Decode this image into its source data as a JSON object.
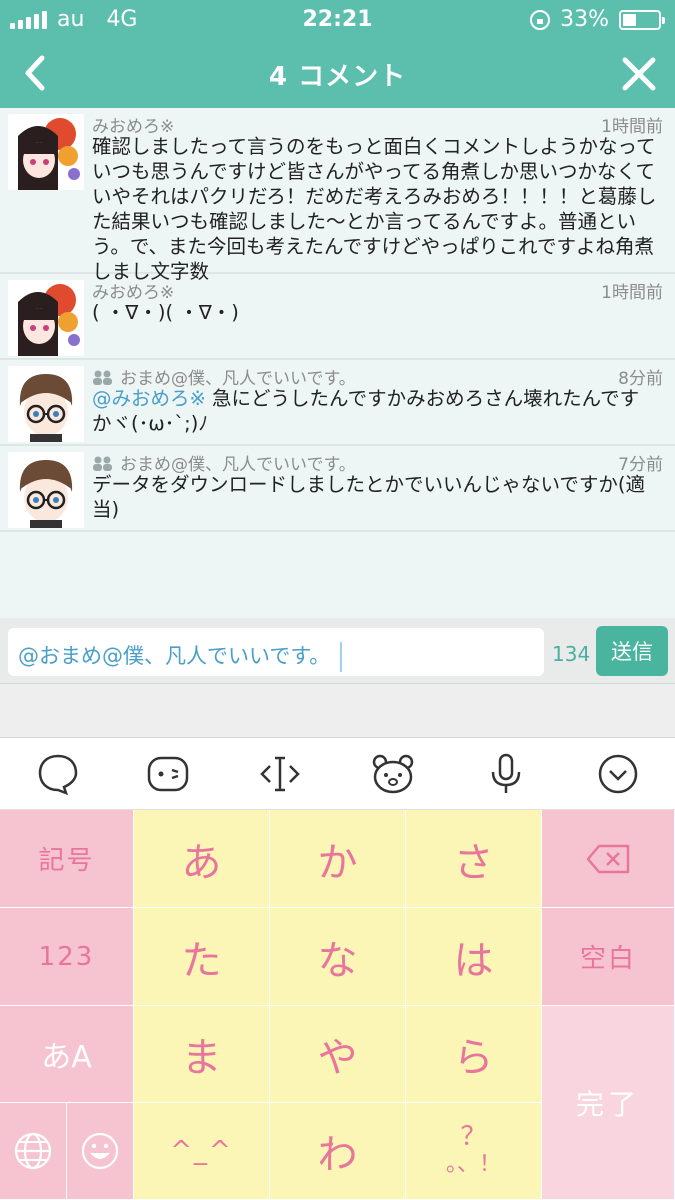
{
  "status_bar": {
    "carrier": "au",
    "network": "4G",
    "time": "22:21",
    "battery": "33%"
  },
  "nav": {
    "title": "4 コメント"
  },
  "comments": [
    {
      "author": "みおめろ※",
      "time": "1時間前",
      "mention": "",
      "text": "確認しましたって言うのをもっと面白くコメントしようかなっていつも思うんですけど皆さんがやってる角煮しか思いつかなくていやそれはパクリだろ！だめだ考えろみおめろ！！！！と葛藤した結果いつも確認しました〜とか言ってるんですよ。普通という。で、また今回も考えたんですけどやっぱりこれですよね角煮しまし文字数"
    },
    {
      "author": "みおめろ※",
      "time": "1時間前",
      "mention": "",
      "text": "( ・∇・)( ・∇・)"
    },
    {
      "author": "おまめ@僕、凡人でいいです。",
      "time": "8分前",
      "mention": "@みおめろ※",
      "text": " 急にどうしたんですかみおめろさん壊れたんですかヾ(･ω･`;)ﾉ"
    },
    {
      "author": "おまめ@僕、凡人でいいです。",
      "time": "7分前",
      "mention": "",
      "text": "データをダウンロードしましたとかでいいんじゃないですか(適当)"
    }
  ],
  "input": {
    "value": "@おまめ@僕、凡人でいいです。",
    "char_count": "134",
    "send_label": "送信"
  },
  "keyboard": {
    "symbols": "記号",
    "numbers": "123",
    "mode": "あA",
    "a": "あ",
    "ka": "か",
    "sa": "さ",
    "ta": "た",
    "na": "な",
    "ha": "は",
    "ma": "ま",
    "ya": "や",
    "ra": "ら",
    "emoticon": "^_^",
    "wa": "わ",
    "punct_top": "？",
    "punct_bottom": "。、！",
    "space": "空白",
    "done": "完了"
  },
  "colors": {
    "header": "#5cbfae",
    "send_button": "#4ab59f",
    "key_text": "#e8769c",
    "key_pink": "#f6c3d1",
    "key_yellow": "#fbf6b6"
  }
}
